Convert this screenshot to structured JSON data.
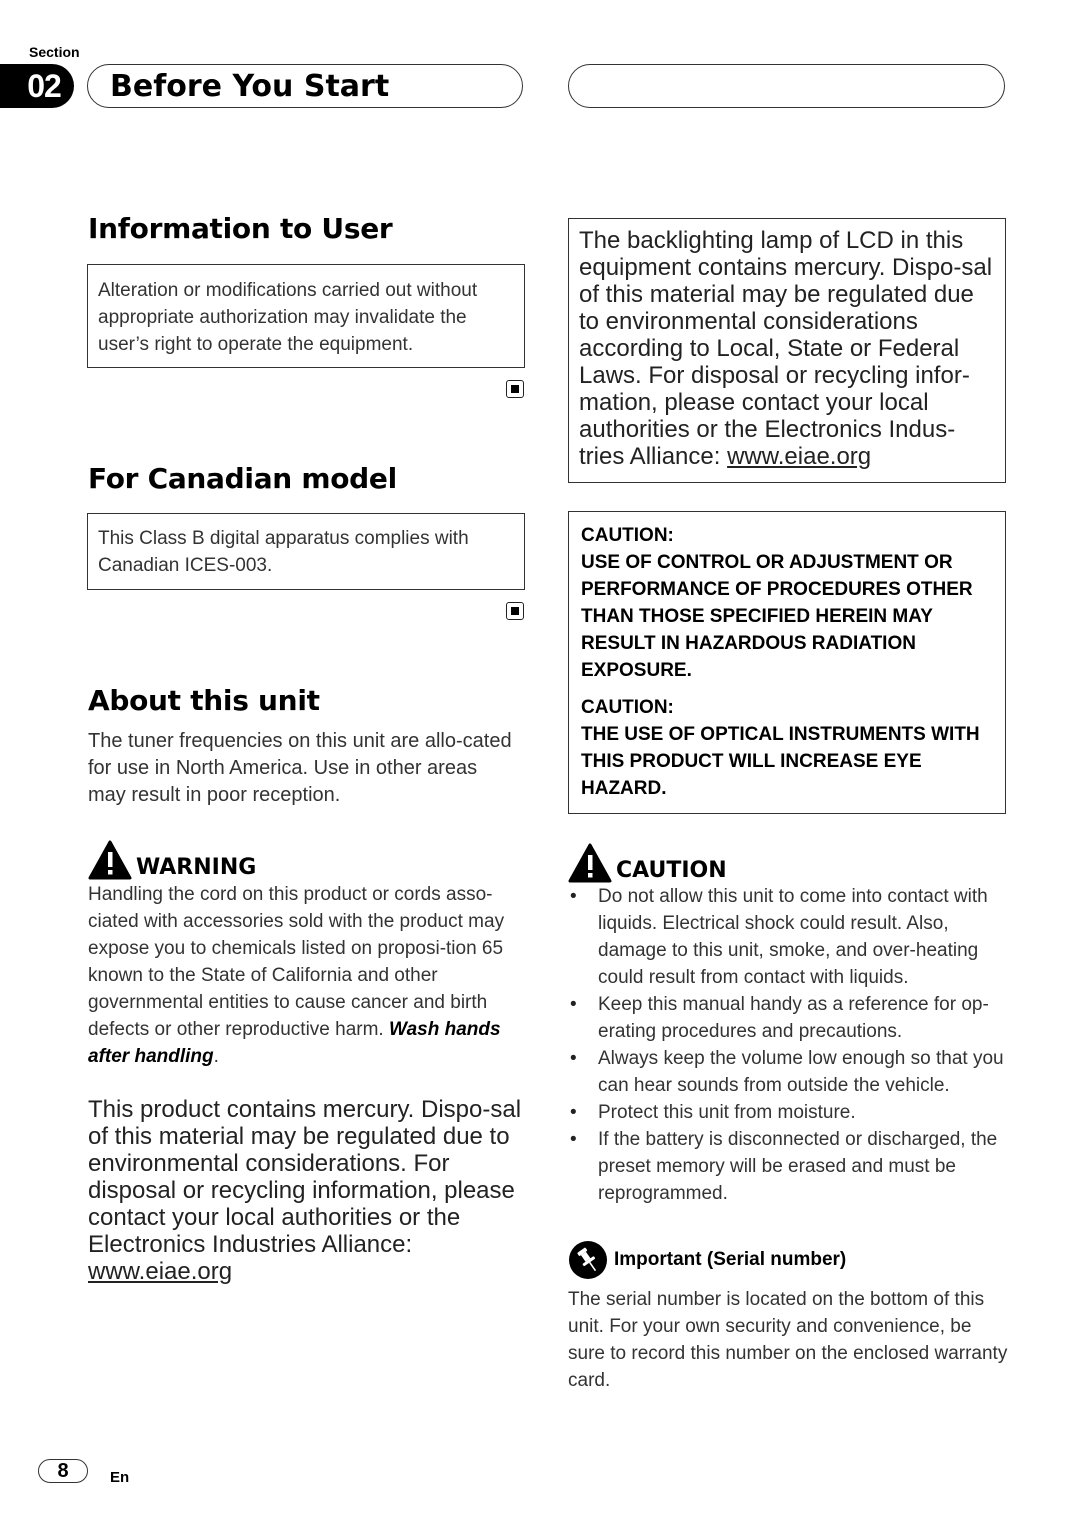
{
  "header": {
    "section_label": "Section",
    "section_number": "02",
    "section_title": "Before You Start"
  },
  "left": {
    "info_user": {
      "heading": "Information to User",
      "box_text": "Alteration or modifications carried out without appropriate authorization may invalidate the user’s right to operate the equipment."
    },
    "canadian": {
      "heading": "For Canadian model",
      "box_text": "This Class B digital apparatus complies with Canadian ICES-003."
    },
    "about": {
      "heading": "About this unit",
      "text": "The tuner frequencies on this unit are allo-cated for use in North America. Use in other areas may result in poor reception."
    },
    "warning": {
      "title": "WARNING",
      "text": "Handling the cord on this product or cords asso-ciated with accessories sold with the product may expose you to chemicals listed on proposi-tion 65 known to the State of California and other governmental entities to cause cancer and birth defects or other reproductive harm. ",
      "emphasis": "Wash hands after handling",
      "end": "."
    },
    "mercury": {
      "text": "This product contains mercury. Dispo-sal of this material may be regulated due to environmental considerations. For disposal or recycling information, please contact your local authorities or the Electronics Industries Alliance: ",
      "link": "www.eiae.org"
    }
  },
  "right": {
    "lcd_box": {
      "text": "The backlighting lamp of LCD in this equipment contains mercury. Dispo-sal of this material may be regulated due to environmental considerations according to Local, State or Federal Laws. For disposal or recycling infor-mation, please contact your local authorities or the Electronics Indus-tries Alliance: ",
      "link": "www.eiae.org"
    },
    "laser_box": {
      "caution1_label": "CAUTION:",
      "caution1_text": "USE OF CONTROL OR ADJUSTMENT OR PERFORMANCE OF PROCEDURES OTHER THAN THOSE SPECIFIED HEREIN MAY RESULT IN HAZARDOUS RADIATION EXPOSURE.",
      "caution2_label": "CAUTION:",
      "caution2_text": "THE USE OF OPTICAL INSTRUMENTS WITH THIS PRODUCT WILL INCREASE EYE HAZARD."
    },
    "caution": {
      "title": "CAUTION",
      "items": [
        "Do not allow this unit to come into contact with liquids. Electrical shock could result. Also, damage to this unit, smoke, and over-heating could result from contact with liquids.",
        "Keep this manual handy as a reference for op-erating procedures and precautions.",
        "Always keep the volume low enough so that you can hear sounds from outside the vehicle.",
        "Protect this unit from moisture.",
        "If the battery is disconnected or discharged, the preset memory will be erased and must be reprogrammed."
      ]
    },
    "important": {
      "title": "Important (Serial number)",
      "text": "The serial number is located on the bottom of this unit. For your own security and convenience, be sure to record this number on the enclosed warranty card."
    }
  },
  "footer": {
    "page_number": "8",
    "language": "En"
  }
}
